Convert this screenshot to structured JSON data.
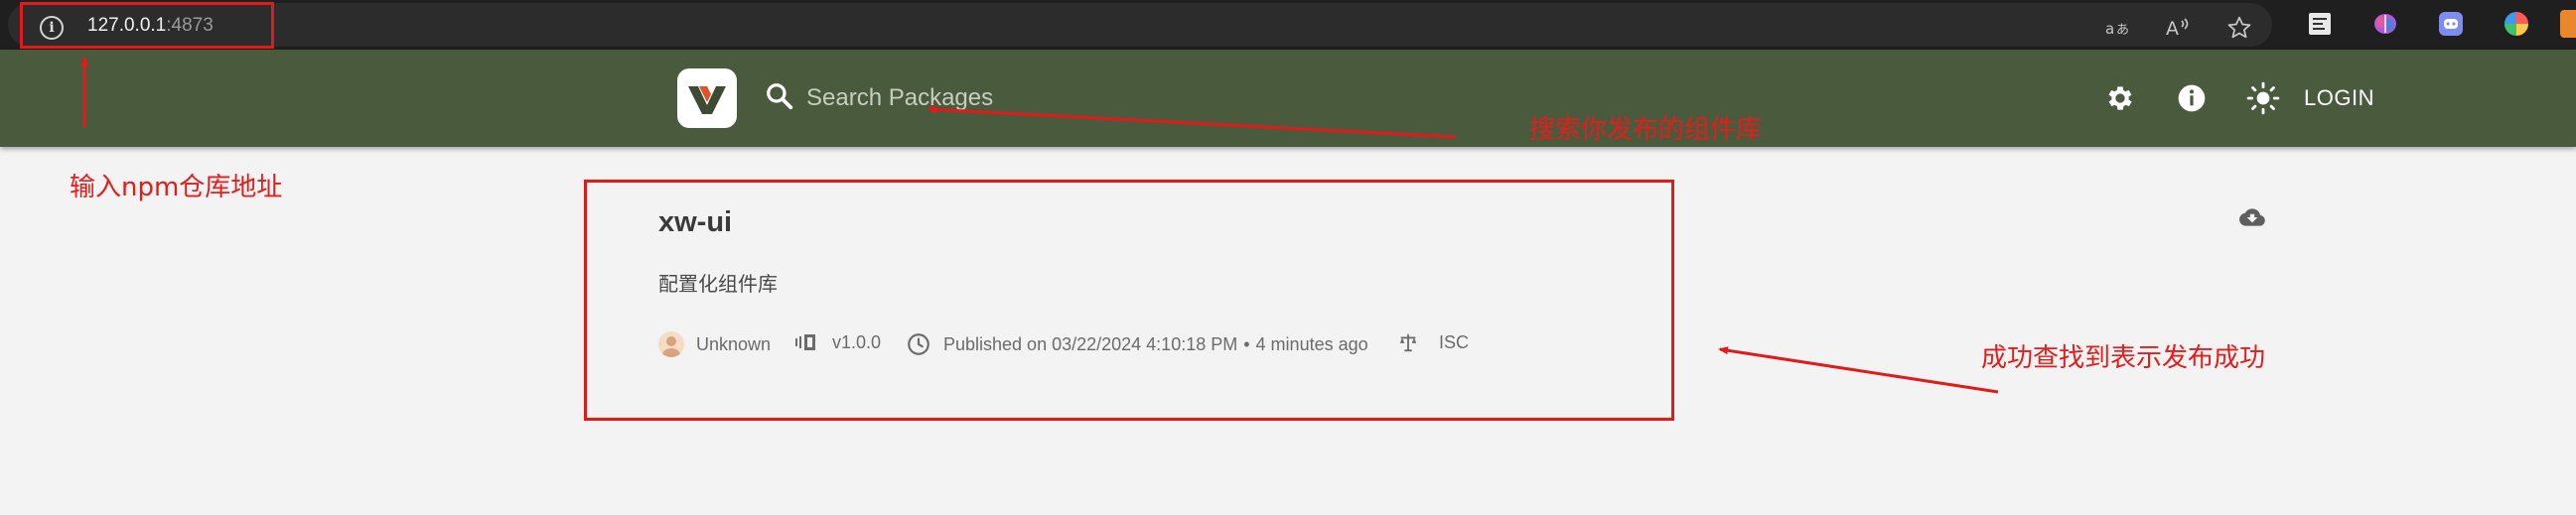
{
  "browser": {
    "url_host": "127.0.0.1",
    "url_port": ":4873",
    "icons": [
      "info-icon",
      "read-aloud-icon",
      "translate-icon",
      "favorite-star-icon"
    ],
    "extensions": [
      "note-extension-icon",
      "brain-extension-icon",
      "discord-extension-icon",
      "color-extension-icon"
    ]
  },
  "header": {
    "search_placeholder": "Search Packages",
    "login_label": "LOGIN",
    "icons": [
      "settings-gear-icon",
      "info-icon",
      "theme-toggle-icon"
    ],
    "colors": {
      "background": "#4a5b3d",
      "text": "#ffffff"
    }
  },
  "package": {
    "name": "xw-ui",
    "description": "配置化组件库",
    "author": "Unknown",
    "version": "v1.0.0",
    "published": "Published on 03/22/2024 4:10:18 PM",
    "published_ago": "4 minutes ago",
    "license": "ISC"
  },
  "annotations": {
    "url_note": "输入npm仓库地址",
    "search_note": "搜索你发布的组件库",
    "result_note": "成功查找到表示发布成功",
    "color": "#e01b1b"
  }
}
